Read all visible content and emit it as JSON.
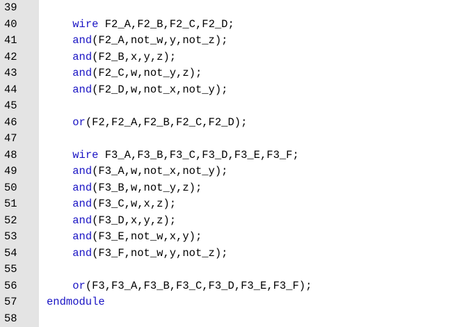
{
  "editor": {
    "lines": [
      {
        "num": "39",
        "tokens": []
      },
      {
        "num": "40",
        "tokens": [
          {
            "t": "    "
          },
          {
            "t": "wire",
            "k": 1
          },
          {
            "t": " F2_A,F2_B,F2_C,F2_D;"
          }
        ]
      },
      {
        "num": "41",
        "tokens": [
          {
            "t": "    "
          },
          {
            "t": "and",
            "k": 1
          },
          {
            "t": "(F2_A,not_w,y,not_z);"
          }
        ]
      },
      {
        "num": "42",
        "tokens": [
          {
            "t": "    "
          },
          {
            "t": "and",
            "k": 1
          },
          {
            "t": "(F2_B,x,y,z);"
          }
        ]
      },
      {
        "num": "43",
        "tokens": [
          {
            "t": "    "
          },
          {
            "t": "and",
            "k": 1
          },
          {
            "t": "(F2_C,w,not_y,z);"
          }
        ]
      },
      {
        "num": "44",
        "tokens": [
          {
            "t": "    "
          },
          {
            "t": "and",
            "k": 1
          },
          {
            "t": "(F2_D,w,not_x,not_y);"
          }
        ]
      },
      {
        "num": "45",
        "tokens": []
      },
      {
        "num": "46",
        "tokens": [
          {
            "t": "    "
          },
          {
            "t": "or",
            "k": 1
          },
          {
            "t": "(F2,F2_A,F2_B,F2_C,F2_D);"
          }
        ]
      },
      {
        "num": "47",
        "tokens": []
      },
      {
        "num": "48",
        "tokens": [
          {
            "t": "    "
          },
          {
            "t": "wire",
            "k": 1
          },
          {
            "t": " F3_A,F3_B,F3_C,F3_D,F3_E,F3_F;"
          }
        ]
      },
      {
        "num": "49",
        "tokens": [
          {
            "t": "    "
          },
          {
            "t": "and",
            "k": 1
          },
          {
            "t": "(F3_A,w,not_x,not_y);"
          }
        ]
      },
      {
        "num": "50",
        "tokens": [
          {
            "t": "    "
          },
          {
            "t": "and",
            "k": 1
          },
          {
            "t": "(F3_B,w,not_y,z);"
          }
        ]
      },
      {
        "num": "51",
        "tokens": [
          {
            "t": "    "
          },
          {
            "t": "and",
            "k": 1
          },
          {
            "t": "(F3_C,w,x,z);"
          }
        ]
      },
      {
        "num": "52",
        "tokens": [
          {
            "t": "    "
          },
          {
            "t": "and",
            "k": 1
          },
          {
            "t": "(F3_D,x,y,z);"
          }
        ]
      },
      {
        "num": "53",
        "tokens": [
          {
            "t": "    "
          },
          {
            "t": "and",
            "k": 1
          },
          {
            "t": "(F3_E,not_w,x,y);"
          }
        ]
      },
      {
        "num": "54",
        "tokens": [
          {
            "t": "    "
          },
          {
            "t": "and",
            "k": 1
          },
          {
            "t": "(F3_F,not_w,y,not_z);"
          }
        ]
      },
      {
        "num": "55",
        "tokens": []
      },
      {
        "num": "56",
        "tokens": [
          {
            "t": "    "
          },
          {
            "t": "or",
            "k": 1
          },
          {
            "t": "(F3,F3_A,F3_B,F3_C,F3_D,F3_E,F3_F);"
          }
        ]
      },
      {
        "num": "57",
        "tokens": [
          {
            "t": "endmodule",
            "k": 1
          }
        ]
      },
      {
        "num": "58",
        "tokens": []
      }
    ]
  },
  "colors": {
    "keyword": "#1a14c4",
    "text": "#000000",
    "gutter_bg": "#e4e4e4",
    "editor_bg": "#ffffff"
  }
}
